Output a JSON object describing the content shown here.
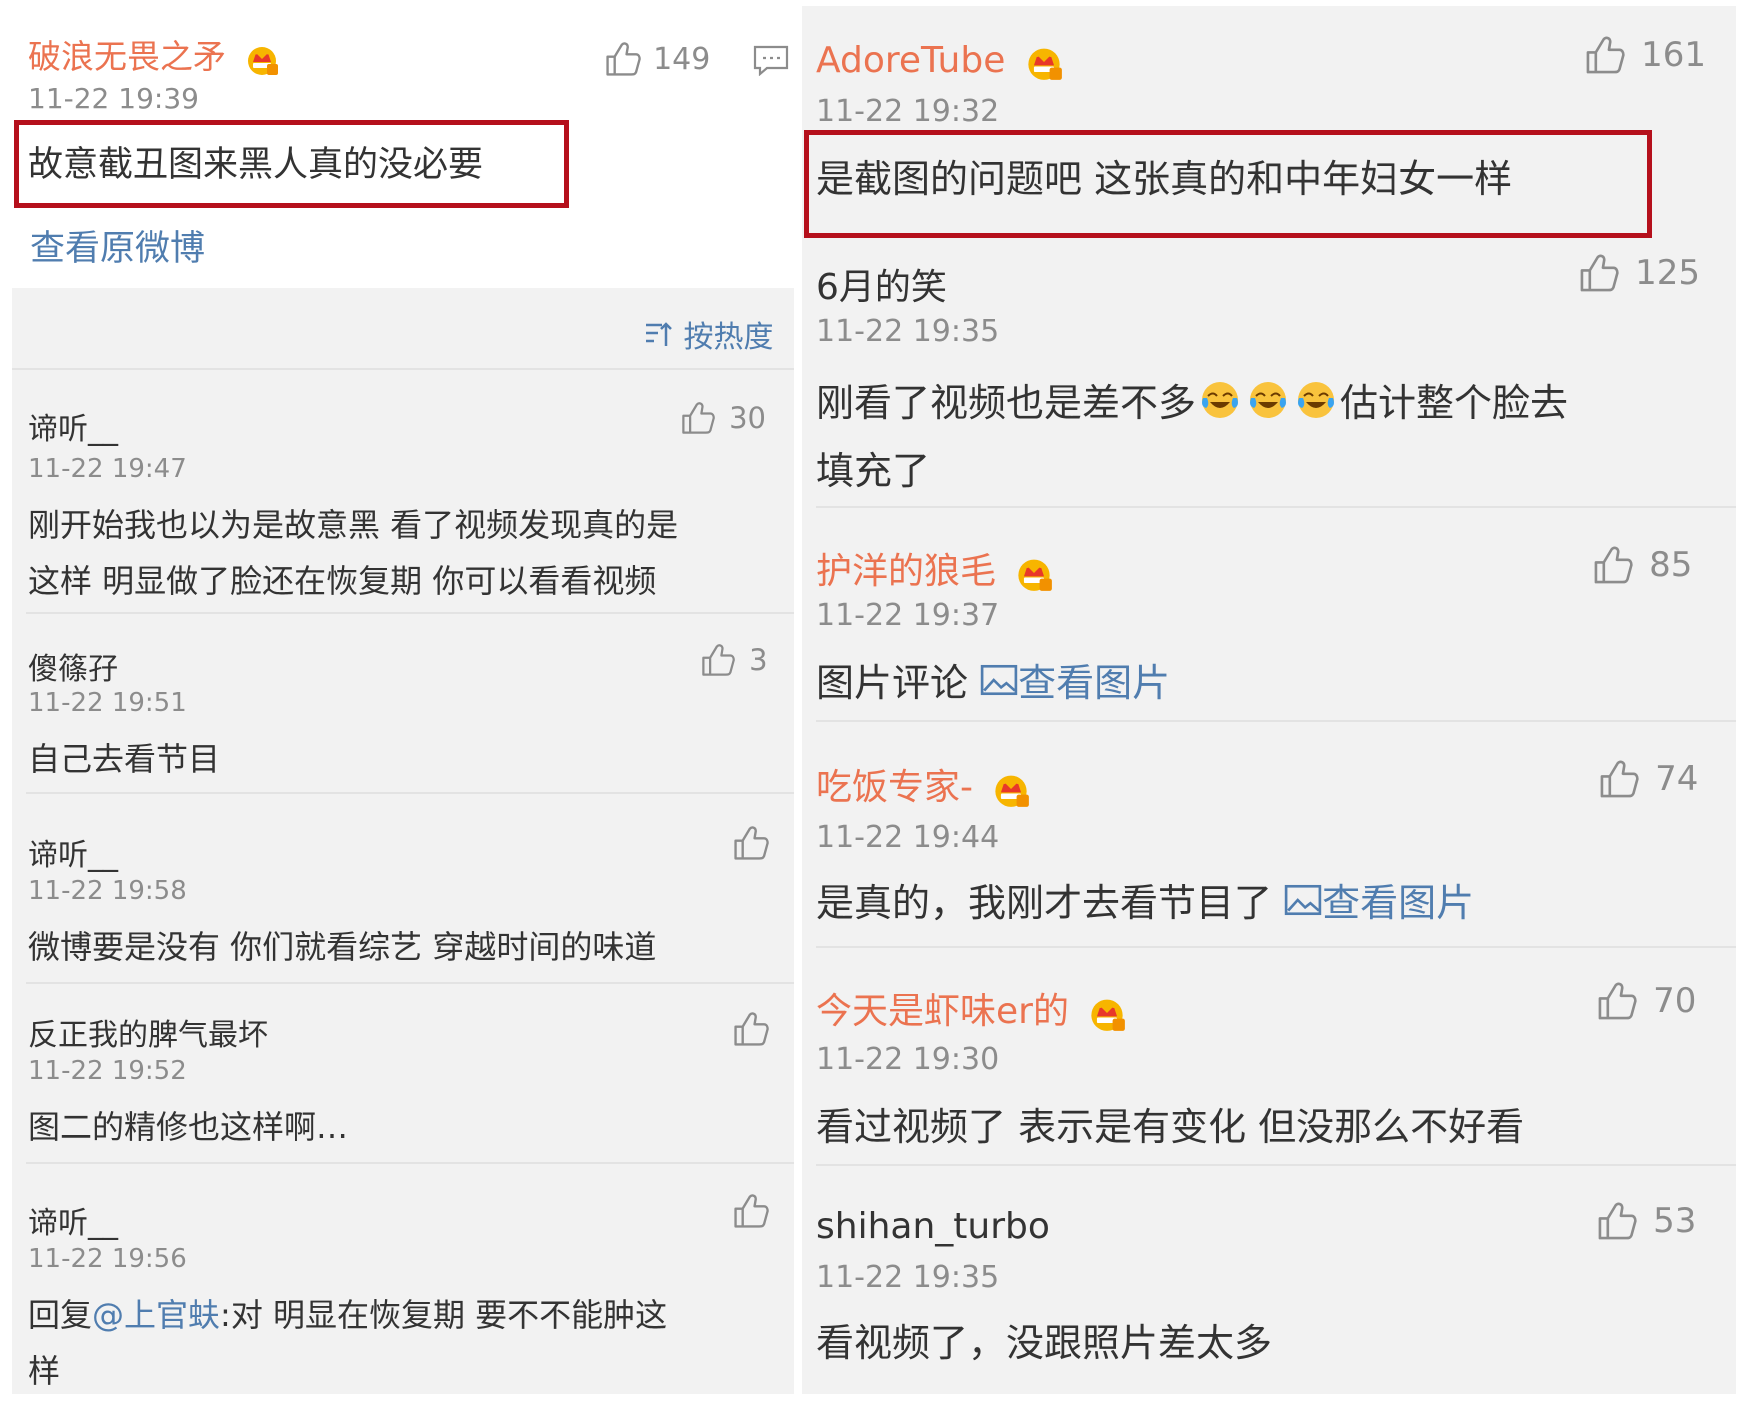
{
  "left": {
    "main": {
      "username": "破浪无畏之矛",
      "time": "11-22 19:39",
      "likes": "149",
      "text": "故意截丑图来黑人真的没必要",
      "view_original": "查看原微博"
    },
    "sort_label": "按热度",
    "replies": [
      {
        "username": "谛听__",
        "time": "11-22 19:47",
        "likes": "30",
        "line1": "刚开始我也以为是故意黑 看了视频发现真的是",
        "line2": "这样 明显做了脸还在恢复期 你可以看看视频"
      },
      {
        "username": "傻篠孖",
        "time": "11-22 19:51",
        "likes": "3",
        "line1": "自己去看节目"
      },
      {
        "username": "谛听__",
        "time": "11-22 19:58",
        "likes": "",
        "line1": "微博要是没有 你们就看综艺 穿越时间的味道"
      },
      {
        "username": "反正我的脾气最坏",
        "time": "11-22 19:52",
        "likes": "",
        "line1": "图二的精修也这样啊…"
      },
      {
        "username": "谛听__",
        "time": "11-22 19:56",
        "likes": "",
        "prefix": "回复",
        "mention": "@上官蚨",
        "line1": ":对 明显在恢复期 要不不能肿这",
        "line2": "样"
      }
    ]
  },
  "right": {
    "comments": [
      {
        "username": "AdoreTube",
        "time": "11-22 19:32",
        "likes": "161",
        "text": "是截图的问题吧 这张真的和中年妇女一样"
      },
      {
        "username": "6月的笑",
        "time": "11-22 19:35",
        "likes": "125",
        "text_a": "刚看了视频也是差不多",
        "text_b": "估计整个脸去",
        "line2": "填充了"
      },
      {
        "username": "护洋的狼毛",
        "time": "11-22 19:37",
        "likes": "85",
        "text": "图片评论",
        "link": "查看图片"
      },
      {
        "username": "吃饭专家-",
        "time": "11-22 19:44",
        "likes": "74",
        "text": "是真的，我刚才去看节目了",
        "link": "查看图片"
      },
      {
        "username": "今天是虾味er的",
        "time": "11-22 19:30",
        "likes": "70",
        "text": "看过视频了 表示是有变化 但没那么不好看"
      },
      {
        "username": "shihan_turbo",
        "time": "11-22 19:35",
        "likes": "53",
        "text": "看视频了，没跟照片差太多"
      }
    ]
  },
  "colors": {
    "orange": "#eb7350",
    "blue": "#507daf",
    "red_box": "#b5101c",
    "gray": "#8c8c8c"
  },
  "icons": [
    "crown-icon",
    "thumb-up-icon",
    "comment-icon",
    "sort-icon",
    "image-icon",
    "laugh-cry-emoji"
  ]
}
